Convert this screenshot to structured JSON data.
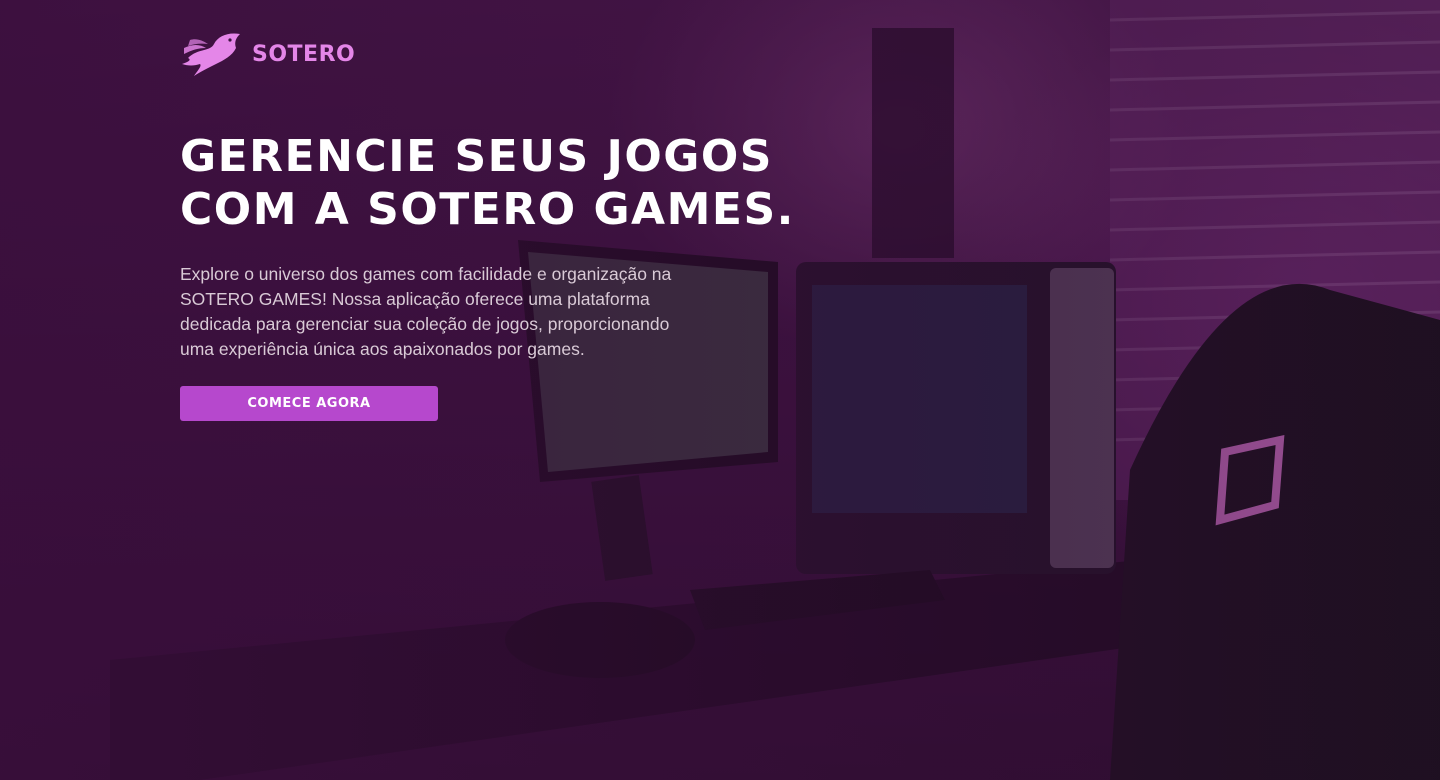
{
  "brand": {
    "name": "SOTERO",
    "logo_icon": "flame-bird-icon",
    "color": "#e486e8"
  },
  "hero": {
    "title_lines": [
      "GERENCIE SEUS JOGOS",
      "COM A SOTERO GAMES."
    ],
    "description": "Explore o universo dos games com facilidade e organização na SOTERO GAMES! Nossa aplicação oferece uma plataforma dedicada para gerenciar sua coleção de jogos, proporcionando uma experiência única aos apaixonados por games.",
    "cta_label": "COMECE AGORA",
    "cta_color": "#b648cd",
    "background_image": "gaming-setup-photo"
  }
}
